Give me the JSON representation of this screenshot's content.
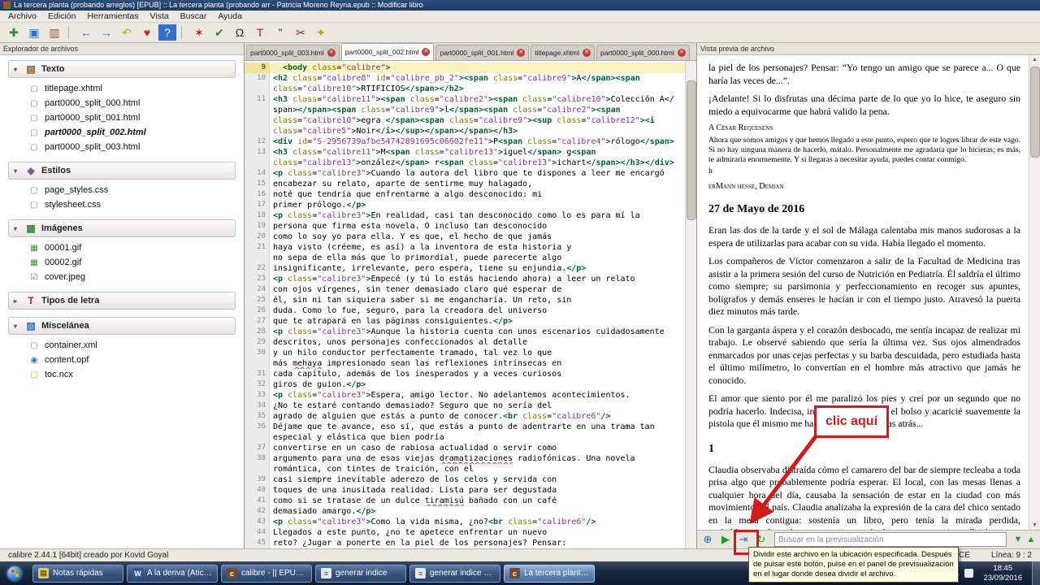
{
  "window": {
    "title": "La tercera planta (probando arreglos) [EPUB] :: La tercera planta (probando arr - Patricia Moreno Reyna.epub :: Modificar libro",
    "menus": [
      "Archivo",
      "Edición",
      "Herramientas",
      "Vista",
      "Buscar",
      "Ayuda"
    ]
  },
  "icons": {
    "close_glyph": "✕"
  },
  "toolbar": {
    "icons": [
      {
        "name": "new-file-icon",
        "glyph": "✚",
        "color": "#2e8f2e"
      },
      {
        "name": "save-icon",
        "glyph": "▣",
        "color": "#2f6fd0"
      },
      {
        "name": "open-book-icon",
        "glyph": "▥",
        "color": "#8a5a2a"
      },
      {
        "name": "toolbar-separator",
        "sep": true
      },
      {
        "name": "back-icon",
        "glyph": "←",
        "color": "#2f6fd0"
      },
      {
        "name": "forward-icon",
        "glyph": "→",
        "color": "#2f6fd0"
      },
      {
        "name": "undo-icon",
        "glyph": "↶",
        "color": "#d99a00"
      },
      {
        "name": "donate-icon",
        "glyph": "♥",
        "color": "#cc2233"
      },
      {
        "name": "help-icon",
        "glyph": "?",
        "color": "#ffffff",
        "circle": "#2f6fd0"
      },
      {
        "name": "toolbar-separator",
        "sep": true
      },
      {
        "name": "check-book-icon",
        "glyph": "✶",
        "color": "#a82222"
      },
      {
        "name": "spellcheck-icon",
        "glyph": "✔",
        "color": "#2e8f2e"
      },
      {
        "name": "special-character-icon",
        "glyph": "Ω",
        "color": "#333333"
      },
      {
        "name": "transform-case-icon",
        "glyph": "T",
        "color": "#c22222"
      },
      {
        "name": "smarten-quotes-icon",
        "glyph": "”",
        "color": "#333333"
      },
      {
        "name": "remove-unused-icon",
        "glyph": "✂",
        "color": "#a82222"
      },
      {
        "name": "beautify-icon",
        "glyph": "✦",
        "color": "#d99a00"
      }
    ]
  },
  "file_browser": {
    "title": "Explorador de archivos",
    "sections": [
      {
        "label": "Texto",
        "arrow": "▾",
        "icon": "▤",
        "icon_color": "#8a5a2a",
        "items": [
          {
            "icon": "▢",
            "icon_color": "#7b8ea8",
            "name": "titlepage.xhtml"
          },
          {
            "icon": "▢",
            "icon_color": "#7b8ea8",
            "name": "part0000_split_000.html"
          },
          {
            "icon": "▢",
            "icon_color": "#7b8ea8",
            "name": "part0000_split_001.html"
          },
          {
            "icon": "▢",
            "icon_color": "#7b8ea8",
            "name": "part0000_split_002.html",
            "current": true
          },
          {
            "icon": "▢",
            "icon_color": "#7b8ea8",
            "name": "part0000_split_003.html"
          }
        ]
      },
      {
        "label": "Estilos",
        "arrow": "▾",
        "icon": "◆",
        "icon_color": "#7b5aa8",
        "items": [
          {
            "icon": "▢",
            "icon_color": "#7b8ea8",
            "name": "page_styles.css"
          },
          {
            "icon": "▢",
            "icon_color": "#7b8ea8",
            "name": "stylesheet.css"
          }
        ]
      },
      {
        "label": "Imágenes",
        "arrow": "▾",
        "icon": "▦",
        "icon_color": "#3a8a3a",
        "items": [
          {
            "icon": "▦",
            "icon_color": "#3a8a3a",
            "name": "00001.gif"
          },
          {
            "icon": "▦",
            "icon_color": "#3a8a3a",
            "name": "00002.gif"
          },
          {
            "icon": "☑",
            "icon_color": "#3a8a3a",
            "name": "cover.jpeg"
          }
        ]
      },
      {
        "label": "Tipos de letra",
        "arrow": "▸",
        "icon": "T",
        "icon_color": "#c22222",
        "items": []
      },
      {
        "label": "Miscelánea",
        "arrow": "▾",
        "icon": "▧",
        "icon_color": "#2f6fd0",
        "items": [
          {
            "icon": "▢",
            "icon_color": "#7b8ea8",
            "name": "container.xml"
          },
          {
            "icon": "◉",
            "icon_color": "#2f6fd0",
            "name": "content.opf"
          },
          {
            "icon": "▢",
            "icon_color": "#d9a520",
            "name": "toc.ncx"
          }
        ]
      }
    ]
  },
  "editor": {
    "tabs": [
      {
        "label": "part0000_split_003.html"
      },
      {
        "label": "part0000_split_002.html",
        "active": true
      },
      {
        "label": "part0000_split_001.html"
      },
      {
        "label": "titlepage.xhtml"
      },
      {
        "label": "part0000_split_000.html"
      }
    ],
    "misspelled": [
      "mehaya",
      "dramatizaciones",
      "tiramisú"
    ],
    "rows": [
      {
        "num": "9",
        "current": true,
        "text": "  <body class=\"calibre\">"
      },
      {
        "num": "10",
        "text": "<h2 class=\"calibre8\" id=\"calibre_pb_2\"><span class=\"calibre9\">A</span><span"
      },
      {
        "num": "",
        "text": "class=\"calibre10\">RTIFICIOS</span></h2>"
      },
      {
        "num": "11",
        "text": "<h3 class=\"calibre11\"><span class=\"calibre2\"><span class=\"calibre10\">Colección A</"
      },
      {
        "num": "",
        "text": "span></span><span class=\"calibre9\">l</span><span class=\"calibre2\"><span"
      },
      {
        "num": "",
        "text": "class=\"calibre10\">egra </span><span class=\"calibre9\"><sup class=\"calibre12\"><i"
      },
      {
        "num": "",
        "text": "class=\"calibre5\">Noir</i></sup></span></span></h3>"
      },
      {
        "num": "12",
        "text": "<div id=\"S-2956739afbe54742891695c06602fe11\">P<span class=\"calibre4\">rólogo</span>"
      },
      {
        "num": "13",
        "text": "<h3 class=\"calibre11\">M<span class=\"calibre13\">iguel</span> g<span"
      },
      {
        "num": "",
        "text": "class=\"calibre13\">onzález</span> r<span class=\"calibre13\">ichart</span></h3></div>"
      },
      {
        "num": "14",
        "text": "<p class=\"calibre3\">Cuando la autora del libro que te dispones a leer me encargó"
      },
      {
        "num": "15",
        "text": "encabezar su relato, aparte de sentirme muy halagado,"
      },
      {
        "num": "16",
        "text": "noté que tendría que enfrentarme a algo desconocido: mi"
      },
      {
        "num": "17",
        "text": "primer prólogo.</p>"
      },
      {
        "num": "18",
        "text": "<p class=\"calibre3\">En realidad, casi tan desconocido como lo es para mí la"
      },
      {
        "num": "19",
        "text": "persona que firma esta novela. O incluso tan desconocido"
      },
      {
        "num": "20",
        "text": "como lo soy yo para ella. Y es que, el hecho de que jamás"
      },
      {
        "num": "21",
        "text": "haya visto (créeme, es así) a la inventora de esta historia y"
      },
      {
        "num": "",
        "text": "no sepa de ella más que lo primordial, puede parecerte algo"
      },
      {
        "num": "22",
        "text": "insignificante, irrelevante, pero espera, tiene su enjundia.</p>"
      },
      {
        "num": "23",
        "text": "<p class=\"calibre3\">Empecé (y tú lo estás haciendo ahora) a leer un relato"
      },
      {
        "num": "24",
        "text": "con ojos vírgenes, sin tener demasiado claro qué esperar de"
      },
      {
        "num": "25",
        "text": "él, sin ni tan siquiera saber si me engancharía. Un reto, sin"
      },
      {
        "num": "26",
        "text": "duda. Como lo fue, seguro, para la creadora del universo"
      },
      {
        "num": "27",
        "text": "que te atrapará en las páginas consiguientes.</p>"
      },
      {
        "num": "28",
        "text": "<p class=\"calibre3\">Aunque la historia cuenta con unos escenarios cuidadosamente"
      },
      {
        "num": "29",
        "text": "descritos, unos personajes confeccionados al detalle"
      },
      {
        "num": "30",
        "text": "y un hilo conductor perfectamente tramado, tal vez lo que"
      },
      {
        "num": "",
        "text": "más mehaya impresionado sean las reflexiones intrínsecas en"
      },
      {
        "num": "31",
        "text": "cada capítulo, además de los inesperados y a veces curiosos"
      },
      {
        "num": "32",
        "text": "giros de guion.</p>"
      },
      {
        "num": "33",
        "text": "<p class=\"calibre3\">Espera, amigo lector. No adelantemos acontecimientos."
      },
      {
        "num": "34",
        "text": "¿No te estaré contando demasiado? Seguro que no sería del"
      },
      {
        "num": "35",
        "text": "agrado de alguien que estás a punto de conocer.<br class=\"calibre6\"/>"
      },
      {
        "num": "36",
        "text": "Déjame que te avance, eso sí, que estás a punto de adentrarte en una trama tan"
      },
      {
        "num": "",
        "text": "especial y elástica que bien podría"
      },
      {
        "num": "37",
        "text": "convertirse en un caso de rabiosa actualidad o servir como"
      },
      {
        "num": "38",
        "text": "argumento para una de esas viejas dramatizaciones radiofónicas. Una novela"
      },
      {
        "num": "",
        "text": "romántica, con tintes de traición, con el"
      },
      {
        "num": "39",
        "text": "casi siempre inevitable aderezo de los celos y servida con"
      },
      {
        "num": "40",
        "text": "toques de una inusitada realidad. Lista para ser degustada"
      },
      {
        "num": "41",
        "text": "como si se tratase de un dulce tiramisú bañado con un café"
      },
      {
        "num": "42",
        "text": "demasiado amargo.</p>"
      },
      {
        "num": "43",
        "text": "<p class=\"calibre3\">Como la vida misma, ¿no?<br class=\"calibre6\"/>"
      },
      {
        "num": "44",
        "text": "Llegados a este punto, ¿no te apetece enfrentar un nuevo"
      },
      {
        "num": "45",
        "text": "reto? ¿Jugar a ponerte en la piel de los personajes? Pensar:"
      }
    ]
  },
  "preview": {
    "title": "Vista previa de archivo",
    "blocks": [
      {
        "type": "para",
        "text": "la piel de los personajes? Pensar: “Yo tengo un amigo que se parece a... O que haría las veces de...”."
      },
      {
        "type": "para",
        "text": "¡Adelante! Si lo disfrutas una décima parte de lo que yo lo hice, te aseguro sin miedo a equivocarme que habrá valido la pena."
      },
      {
        "type": "smallcaps",
        "text": "A César Requesens"
      },
      {
        "type": "small",
        "text": "Ahora que somos amigos y que hemos llegado a este punto, espero que te logres librar de este vago. Si no hay ninguna manera de hacerlo, mátalo. Personalmente me agradaría que lo hicieras; es más, te admiraría enormemente. Y si llegaras a necesitar ayuda, puedes contar conmigo."
      },
      {
        "type": "small",
        "text": "h"
      },
      {
        "type": "smallcaps",
        "text": "erMann hesse, Demian"
      },
      {
        "type": "heading",
        "text": "27 de Mayo de 2016"
      },
      {
        "type": "para",
        "text": "Eran las dos de la tarde y el sol de Málaga calentaba mis manos sudorosas a la espera de utilizarlas para acabar con su vida. Había llegado el momento."
      },
      {
        "type": "para",
        "text": "Los compañeros de Víctor comenzaron a salir de la Facultad de Medicina tras asistir a la primera sesión del curso de Nutrición en Pediatría. Él saldría el último como siempre; su parsimonia y perfeccionamiento en recoger sus apuntes, bolígrafos y demás enseres le hacían ir con el tiempo justo. Atravesó la puerta diez minutos más tarde."
      },
      {
        "type": "para",
        "text": "Con la garganta áspera y el corazón desbocado, me sentía incapaz de realizar mi trabajo. Le observé sabiendo que sería la última vez. Sus ojos almendrados enmarcados por unas cejas perfectas y su barba descuidada, pero estudiada hasta el último milímetro, lo convertían en el hombre más atractivo que jamás he conocido."
      },
      {
        "type": "para",
        "text": "El amor que siento por él me paralizó los pies y creí por un segundo que no podría hacerlo. Indecisa, introduje la mano en el bolso y acaricié suavemente la pistola que él mismo me había regalado semanas atrás..."
      },
      {
        "type": "heading",
        "text": "1"
      },
      {
        "type": "para",
        "text": "Claudia observaba distraída cómo el camarero del bar de siempre tecleaba a toda prisa algo que probablemente podría esperar. El local, con las mesas llenas a cualquier hora del día, causaba la sensación de estar en la ciudad con más movimiento del país. Claudia analizaba la expresión de la cara del chico sentado en la mesa contigua: sostenía un libro, pero tenía la mirada perdida, probablemente buceaba entre sonrisas y olvidos, ya que sus ojos reflejaban arre- pentimiento y frustración. Mientras tanto, Helena, su mejor amiga, le hablaba acerca de los despidos que se iban a producirse en su trabajo en las próximas semanas."
      }
    ],
    "toolbar": {
      "buttons": [
        {
          "name": "open-in-browser-button",
          "glyph": "⊕",
          "color": "#1566c0"
        },
        {
          "name": "run-button",
          "glyph": "▶",
          "color": "#1f9d27"
        },
        {
          "name": "split-file-button",
          "glyph": "⇥",
          "color": "#2a6fc9"
        },
        {
          "name": "refresh-button",
          "glyph": "↻",
          "color": "#1f9d27"
        }
      ],
      "search_placeholder": "Buscar en la previsualización",
      "nav_buttons": [
        {
          "name": "find-next-button",
          "glyph": "▼",
          "color": "#1f9d27"
        },
        {
          "name": "find-prev-button",
          "glyph": "▲",
          "color": "#1f9d27"
        }
      ]
    }
  },
  "annotation": {
    "label": "clic aquí"
  },
  "tooltip": {
    "text": "Dividir este archivo en la ubicación especificada. Después de pulsar este botón, pulse en el panel de previsualización en el lugar donde desea dividir el archivo."
  },
  "status_bar": {
    "left": "calibre 2.44.1 [64bit] creado por Kovid Goyal",
    "right_key": "SPACE",
    "right_pos": "Línea: 9 : 2"
  },
  "taskbar": {
    "buttons": [
      {
        "label": "Notas rápidas",
        "icon_bg": "#e8c93e",
        "icon_fg": "#6b5a10",
        "icon_glyph": "▤"
      },
      {
        "label": "A la deriva (Ático ...",
        "icon_bg": "#2b579a",
        "icon_fg": "#ffffff",
        "icon_glyph": "W"
      },
      {
        "label": "calibre - || EPUB 2...",
        "icon_bg": "#7a4a21",
        "icon_fg": "#ffffff",
        "icon_glyph": "c"
      },
      {
        "label": "generar indice",
        "icon_bg": "#e8e8e8",
        "icon_fg": "#555555",
        "icon_glyph": "≡"
      },
      {
        "label": "generar indice 7.j...",
        "icon_bg": "#e8e8e8",
        "icon_fg": "#555555",
        "icon_glyph": "≡"
      },
      {
        "label": "La tercera planta (...",
        "icon_bg": "#7a4a21",
        "icon_fg": "#ffffff",
        "icon_glyph": "c",
        "active": true
      }
    ],
    "clock": {
      "time": "18:45",
      "date": "23/09/2016"
    }
  }
}
